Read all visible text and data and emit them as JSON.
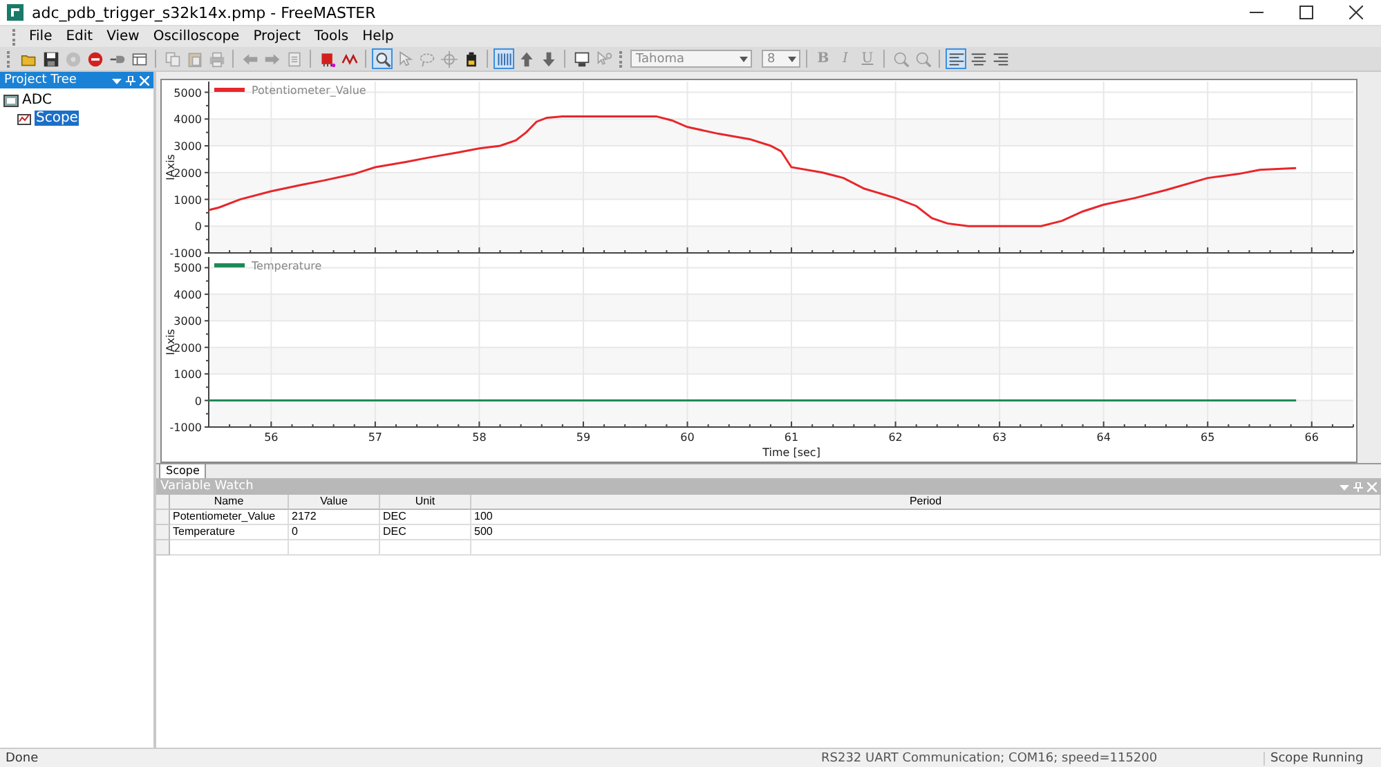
{
  "window": {
    "title": "adc_pdb_trigger_s32k14x.pmp - FreeMASTER"
  },
  "menu": [
    "File",
    "Edit",
    "View",
    "Oscilloscope",
    "Project",
    "Tools",
    "Help"
  ],
  "toolbar": {
    "items": [
      {
        "kind": "button",
        "on": false,
        "disabled": false
      },
      {
        "kind": "button",
        "on": false,
        "disabled": false
      },
      {
        "kind": "button",
        "on": false,
        "disabled": true
      },
      {
        "kind": "button",
        "on": false,
        "disabled": false
      },
      {
        "kind": "button",
        "on": false,
        "disabled": false
      },
      {
        "kind": "button",
        "on": false,
        "disabled": false
      },
      {
        "kind": "separator"
      },
      {
        "kind": "button",
        "on": false,
        "disabled": true
      },
      {
        "kind": "button",
        "on": false,
        "disabled": true
      },
      {
        "kind": "button",
        "on": false,
        "disabled": true
      },
      {
        "kind": "separator"
      },
      {
        "kind": "button",
        "on": false,
        "disabled": true
      },
      {
        "kind": "button",
        "on": false,
        "disabled": true
      },
      {
        "kind": "button",
        "on": false,
        "disabled": true
      },
      {
        "kind": "separator"
      },
      {
        "kind": "button",
        "on": false,
        "disabled": false
      },
      {
        "kind": "button",
        "on": false,
        "disabled": false
      },
      {
        "kind": "separator"
      },
      {
        "kind": "button",
        "on": true,
        "disabled": false
      },
      {
        "kind": "button",
        "on": false,
        "disabled": true
      },
      {
        "kind": "button",
        "on": false,
        "disabled": true
      },
      {
        "kind": "button",
        "on": false,
        "disabled": true
      },
      {
        "kind": "button",
        "on": false,
        "disabled": false
      },
      {
        "kind": "separator"
      },
      {
        "kind": "button",
        "on": true,
        "disabled": false
      },
      {
        "kind": "button",
        "on": false,
        "disabled": false
      },
      {
        "kind": "button",
        "on": false,
        "disabled": false
      },
      {
        "kind": "separator"
      },
      {
        "kind": "button",
        "on": false,
        "disabled": false
      },
      {
        "kind": "button",
        "on": false,
        "disabled": true
      },
      {
        "kind": "grip"
      },
      {
        "kind": "font",
        "value": "Tahoma",
        "disabled": true
      },
      {
        "kind": "size",
        "value": "8",
        "disabled": true
      },
      {
        "kind": "separator"
      },
      {
        "kind": "text",
        "label": "B",
        "disabled": true
      },
      {
        "kind": "text",
        "label": "I",
        "disabled": true
      },
      {
        "kind": "text",
        "label": "U",
        "disabled": true
      },
      {
        "kind": "separator"
      },
      {
        "kind": "button",
        "on": false,
        "disabled": true
      },
      {
        "kind": "button",
        "on": false,
        "disabled": true
      },
      {
        "kind": "separator"
      },
      {
        "kind": "button",
        "on": true,
        "disabled": false
      },
      {
        "kind": "button",
        "on": false,
        "disabled": false
      },
      {
        "kind": "button",
        "on": false,
        "disabled": false
      }
    ]
  },
  "project_tree": {
    "title": "Project Tree",
    "active": true,
    "items": [
      {
        "label": "ADC",
        "selected": false,
        "children": [
          {
            "label": "Scope",
            "selected": true
          }
        ]
      }
    ]
  },
  "scope": {
    "charts": [
      {
        "chart_data": {
          "type": "line",
          "grid": true,
          "ylabel": "IAxis",
          "xlim": [
            55.4,
            66.4
          ],
          "ylim": [
            -1000,
            5400
          ],
          "yticks": [
            -1000,
            0,
            1000,
            2000,
            3000,
            4000,
            5000
          ],
          "x": [
            55.4,
            55.5,
            55.7,
            56,
            56.3,
            56.5,
            56.8,
            57,
            57.3,
            57.5,
            57.8,
            58,
            58.2,
            58.35,
            58.45,
            58.55,
            58.65,
            58.8,
            59.2,
            59.7,
            59.85,
            60,
            60.3,
            60.6,
            60.8,
            60.9,
            61,
            61.3,
            61.5,
            61.7,
            62,
            62.2,
            62.35,
            62.5,
            62.7,
            63,
            63.4,
            63.6,
            63.8,
            64,
            64.3,
            64.6,
            65,
            65.3,
            65.5,
            65.85
          ],
          "series": [
            {
              "name": "Potentiometer_Value",
              "color": "#e8262b",
              "values": [
                600,
                700,
                1000,
                1300,
                1550,
                1700,
                1950,
                2200,
                2400,
                2550,
                2750,
                2900,
                3000,
                3200,
                3500,
                3900,
                4050,
                4100,
                4100,
                4100,
                3950,
                3700,
                3450,
                3250,
                3000,
                2800,
                2200,
                2000,
                1800,
                1400,
                1050,
                750,
                300,
                100,
                0,
                0,
                0,
                200,
                550,
                800,
                1050,
                1350,
                1800,
                1950,
                2100,
                2170
              ]
            }
          ]
        }
      },
      {
        "chart_data": {
          "type": "line",
          "grid": true,
          "ylabel": "IAxis",
          "xlabel": "Time [sec]",
          "xlim": [
            55.4,
            66.4
          ],
          "ylim": [
            -1000,
            5400
          ],
          "yticks": [
            -1000,
            0,
            1000,
            2000,
            3000,
            4000,
            5000
          ],
          "xticks": [
            56,
            57,
            58,
            59,
            60,
            61,
            62,
            63,
            64,
            65,
            66
          ],
          "x": [
            55.4,
            65.85
          ],
          "series": [
            {
              "name": "Temperature",
              "color": "#1e8a55",
              "values": [
                0,
                0
              ]
            }
          ]
        }
      }
    ],
    "tabs": [
      {
        "label": "Scope",
        "selected": true
      }
    ]
  },
  "variable_watch": {
    "title": "Variable Watch",
    "active": false,
    "columns": [
      "Name",
      "Value",
      "Unit",
      "Period"
    ],
    "rows": [
      [
        "Potentiometer_Value",
        "2172",
        "DEC",
        "100"
      ],
      [
        "Temperature",
        "0",
        "DEC",
        "500"
      ]
    ]
  },
  "status_bar": {
    "message": "Done",
    "connection": "RS232 UART Communication; COM16; speed=115200",
    "state": "Scope Running"
  }
}
